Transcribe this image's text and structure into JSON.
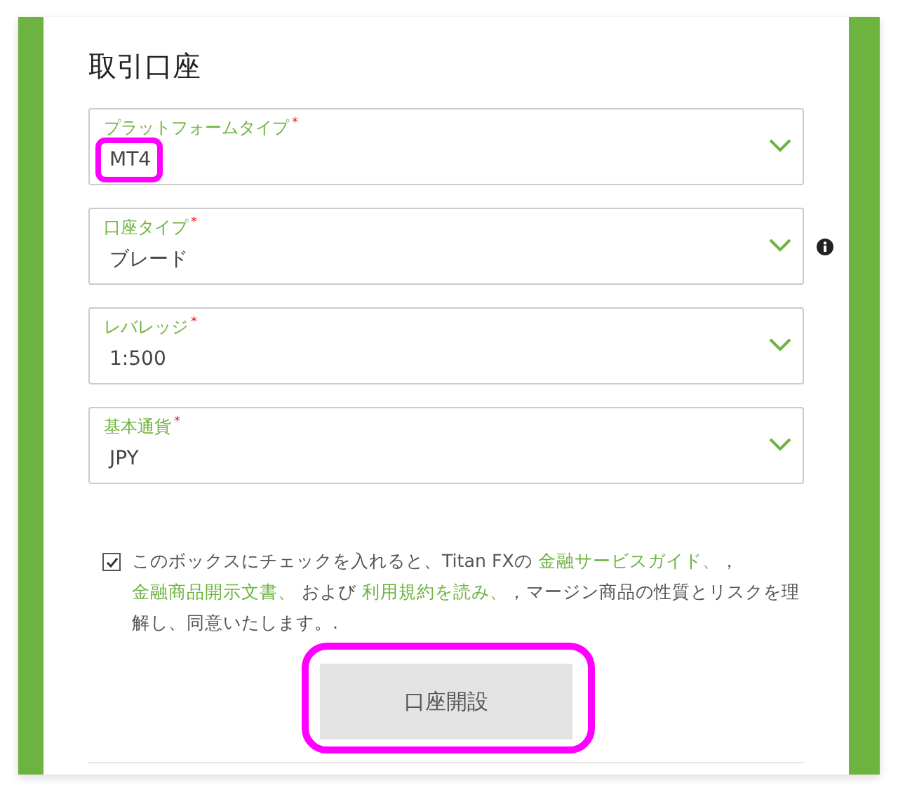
{
  "section": {
    "title": "取引口座"
  },
  "fields": [
    {
      "label": "プラットフォームタイプ",
      "required_mark": "*",
      "value": "MT4",
      "info": false,
      "highlighted": true
    },
    {
      "label": "口座タイプ",
      "required_mark": "*",
      "value": "ブレード",
      "info": true,
      "highlighted": false
    },
    {
      "label": "レバレッジ",
      "required_mark": "*",
      "value": "1:500",
      "info": false,
      "highlighted": false
    },
    {
      "label": "基本通貨",
      "required_mark": "*",
      "value": "JPY",
      "info": false,
      "highlighted": false
    }
  ],
  "agreement": {
    "checked": true,
    "segments": [
      {
        "kind": "plain",
        "text": "このボックスにチェックを入れると、Titan FXの "
      },
      {
        "kind": "link",
        "text": "金融サービスガイド、"
      },
      {
        "kind": "plain",
        "text": "，"
      },
      {
        "kind": "link",
        "text": "金融商品開示文書、"
      },
      {
        "kind": "plain",
        "text": " および "
      },
      {
        "kind": "link",
        "text": "利用規約を読み、"
      },
      {
        "kind": "plain",
        "text": "，マージン商品の性質とリスクを理解し、同意いたします。."
      }
    ]
  },
  "submit": {
    "label": "口座開設",
    "highlighted": true
  }
}
